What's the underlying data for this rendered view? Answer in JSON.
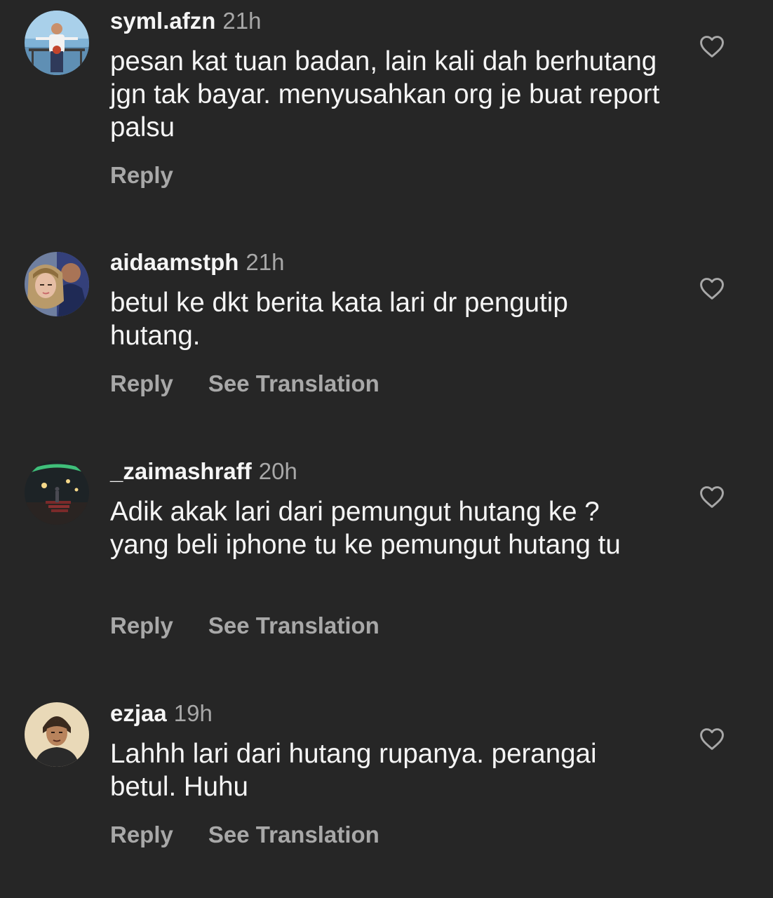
{
  "comments": [
    {
      "username": "syml.afzn",
      "time": "21h",
      "text": "pesan kat tuan badan, lain kali dah berhutang jgn tak bayar. menyusahkan org je buat report palsu",
      "reply_label": "Reply",
      "translation_label": ""
    },
    {
      "username": "aidaamstph",
      "time": "21h",
      "text": "betul ke dkt berita kata lari dr pengutip hutang.",
      "reply_label": "Reply",
      "translation_label": "See Translation"
    },
    {
      "username": "_zaimashraff",
      "time": "20h",
      "text": "Adik akak lari dari pemungut hutang ke ? yang beli iphone tu ke pemungut hutang tu",
      "reply_label": "Reply",
      "translation_label": "See Translation"
    },
    {
      "username": "ezjaa",
      "time": "19h",
      "text": "Lahhh lari dari hutang rupanya. perangai betul. Huhu",
      "reply_label": "Reply",
      "translation_label": "See Translation"
    }
  ],
  "icons": {
    "like": "heart-outline-icon"
  },
  "colors": {
    "background": "#262626",
    "primary_text": "#f5f5f5",
    "secondary_text": "#a8a8a8"
  }
}
